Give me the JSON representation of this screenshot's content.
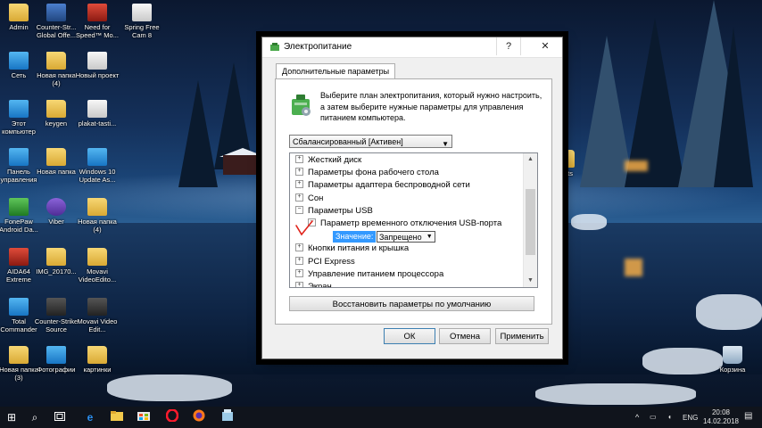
{
  "desktop": {
    "icons": [
      {
        "label": "Admin",
        "type": "folder"
      },
      {
        "label": "Counter-Str... Global Offe...",
        "type": "app"
      },
      {
        "label": "Need for Speed™ Mo...",
        "type": "red"
      },
      {
        "label": "Spring Free Cam 8",
        "type": "white"
      },
      {
        "label": "Сеть",
        "type": "blue"
      },
      {
        "label": "Новая папка (4)",
        "type": "folder"
      },
      {
        "label": "Новый проект",
        "type": "white"
      },
      {
        "label": "Этот компьютер",
        "type": "blue"
      },
      {
        "label": "keygen",
        "type": "folder"
      },
      {
        "label": "plakat-tasti...",
        "type": "white"
      },
      {
        "label": "Панель управления",
        "type": "blue"
      },
      {
        "label": "Новая папка",
        "type": "folder"
      },
      {
        "label": "Windows 10 Update As...",
        "type": "blue"
      },
      {
        "label": "FonePaw Android Da...",
        "type": "green"
      },
      {
        "label": "Viber",
        "type": "purple"
      },
      {
        "label": "Новая папка (4)",
        "type": "folder"
      },
      {
        "label": "AIDA64 Extreme",
        "type": "red"
      },
      {
        "label": "IMG_20170...",
        "type": "folder"
      },
      {
        "label": "Movavi VideoEdito...",
        "type": "folder"
      },
      {
        "label": "Total Commander",
        "type": "blue"
      },
      {
        "label": "Counter-Strike Source",
        "type": "dark"
      },
      {
        "label": "Movavi Video Edit...",
        "type": "dark"
      },
      {
        "label": "Новая папка (3)",
        "type": "folder"
      },
      {
        "label": "Фотографии",
        "type": "blue"
      },
      {
        "label": "картинки",
        "type": "folder"
      },
      {
        "label": "Корзина",
        "type": "trash"
      },
      {
        "label": "cripts",
        "type": "folder"
      }
    ]
  },
  "dialog": {
    "title": "Электропитание",
    "help_glyph": "?",
    "close_glyph": "✕",
    "tab_label": "Дополнительные параметры",
    "description": "Выберите план электропитания, который нужно настроить, а затем выберите нужные параметры для управления питанием компьютера.",
    "plan_value": "Сбалансированный [Активен]",
    "tree": [
      {
        "label": "Жесткий диск",
        "level": 0,
        "expander": "+"
      },
      {
        "label": "Параметры фона рабочего стола",
        "level": 0,
        "expander": "+"
      },
      {
        "label": "Параметры адаптера беспроводной сети",
        "level": 0,
        "expander": "+"
      },
      {
        "label": "Сон",
        "level": 0,
        "expander": "+"
      },
      {
        "label": "Параметры USB",
        "level": 0,
        "expander": "−"
      },
      {
        "label": "Параметр временного отключения USB-порта",
        "level": 1,
        "expander": "−"
      },
      {
        "label": "",
        "level": 2,
        "expander": ""
      },
      {
        "label": "Кнопки питания и крышка",
        "level": 0,
        "expander": "+"
      },
      {
        "label": "PCI Express",
        "level": 0,
        "expander": "+"
      },
      {
        "label": "Управление питанием процессора",
        "level": 0,
        "expander": "+"
      },
      {
        "label": "Экран",
        "level": 0,
        "expander": "+"
      }
    ],
    "value_label": "Значение:",
    "value_selected": "Запрещено",
    "restore_button": "Восстановить параметры по умолчанию",
    "ok_button": "ОК",
    "cancel_button": "Отмена",
    "apply_button": "Применить"
  },
  "taskbar": {
    "start_glyph": "⊞",
    "search_glyph": "⌕",
    "lang": "ENG",
    "time": "20:08",
    "date": "14.02.2018"
  },
  "colors": {
    "selection": "#3399ff",
    "accent_check": "#e0231b"
  }
}
